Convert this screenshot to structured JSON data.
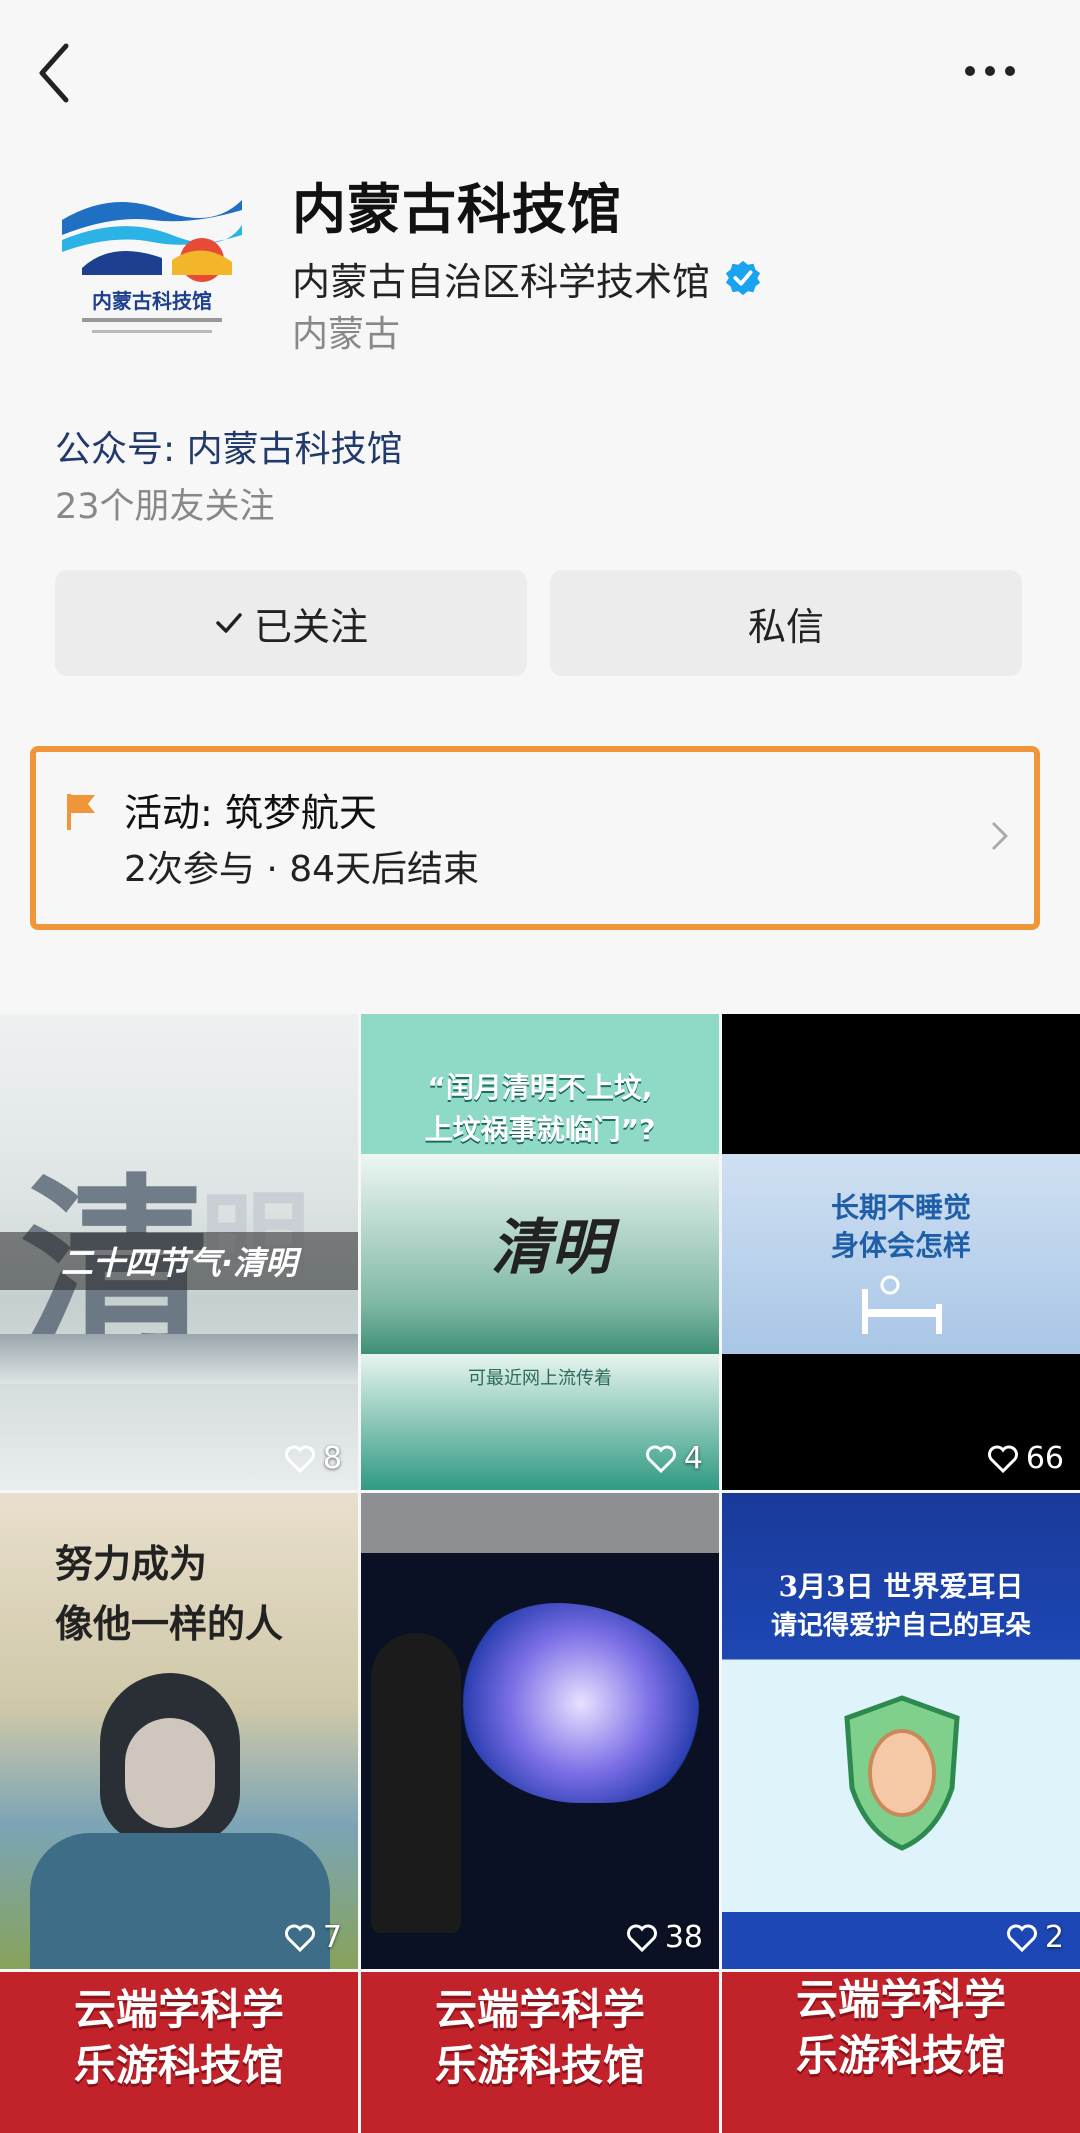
{
  "header": {
    "back_icon": "chevron-left-icon",
    "more_icon": "more-horizontal-icon"
  },
  "profile": {
    "name": "内蒙古科技馆",
    "logo_text": "内蒙古科技馆",
    "organization": "内蒙古自治区科学技术馆",
    "verified_icon": "verified-badge-icon",
    "region": "内蒙古",
    "account_label": "公众号: 内蒙古科技馆",
    "followers_text": "23个朋友关注"
  },
  "actions": {
    "follow_label": "已关注",
    "message_label": "私信"
  },
  "activity": {
    "title": "活动: 筑梦航天",
    "meta": "2次参与 · 84天后结束",
    "highlight_color": "#f0963a"
  },
  "grid": [
    {
      "id": "t1",
      "texts": [
        "二十四节气·清明"
      ],
      "likes": "8"
    },
    {
      "id": "t2",
      "texts": [
        "“闰月清明不上坟,",
        "上坟祸事就临门”?",
        "可最近网上流传着"
      ],
      "likes": "4"
    },
    {
      "id": "t3",
      "texts": [
        "长期不睡觉",
        "身体会怎样"
      ],
      "likes": "66"
    },
    {
      "id": "t4",
      "texts": [
        "努力成为",
        "像他一样的人"
      ],
      "likes": "7"
    },
    {
      "id": "t5",
      "texts": [],
      "likes": "38"
    },
    {
      "id": "t6",
      "texts": [
        "3月3日 世界爱耳日",
        "请记得爱护自己的耳朵"
      ],
      "likes": "2"
    },
    {
      "id": "t7",
      "texts": [
        "云端学科学",
        "乐游科技馆"
      ],
      "likes": ""
    },
    {
      "id": "t8",
      "texts": [
        "云端学科学",
        "乐游科技馆"
      ],
      "likes": ""
    },
    {
      "id": "t9",
      "texts": [
        "云端学科学",
        "乐游科技馆"
      ],
      "likes": ""
    }
  ],
  "colors": {
    "accent_blue": "#1aa3f0",
    "account_blue": "#213a6b"
  }
}
